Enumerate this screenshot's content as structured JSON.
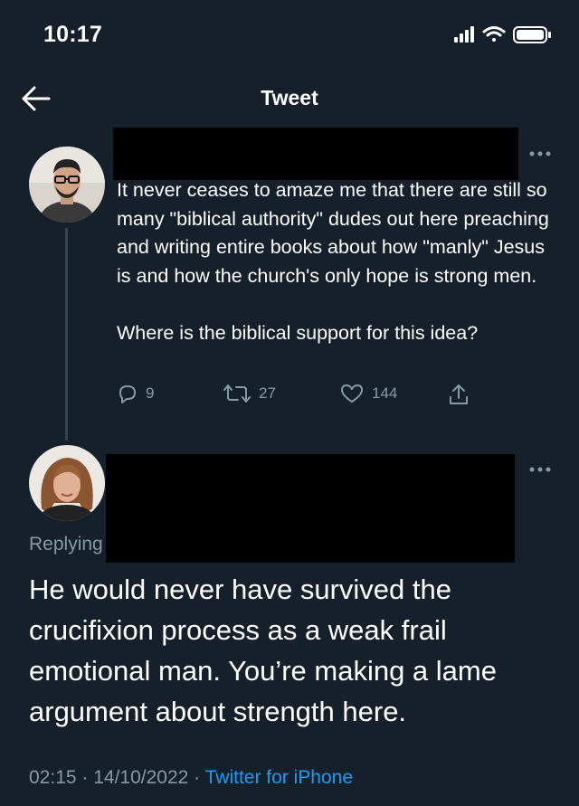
{
  "status_bar": {
    "time": "10:17"
  },
  "header": {
    "title": "Tweet"
  },
  "tweet": {
    "text_lines_1": "It never ceases to amaze me that there are still so many \"biblical authority\" dudes out here preaching and writing entire books about how \"manly\" Jesus is and how the church's only hope is strong men.",
    "text_lines_2": "Where is the biblical support for this idea?",
    "reply_count": "9",
    "retweet_count": "27",
    "like_count": "144"
  },
  "reply": {
    "replying_label": "Replying",
    "text": "He would never have survived the crucifixion process as a weak frail emotional man. You’re making a lame argument about strength here.",
    "timestamp": "02:15 · 14/10/2022 · ",
    "source": "Twitter for iPhone"
  },
  "colors": {
    "background": "#15202b",
    "muted": "#8899a6",
    "link": "#1d9bf0"
  }
}
